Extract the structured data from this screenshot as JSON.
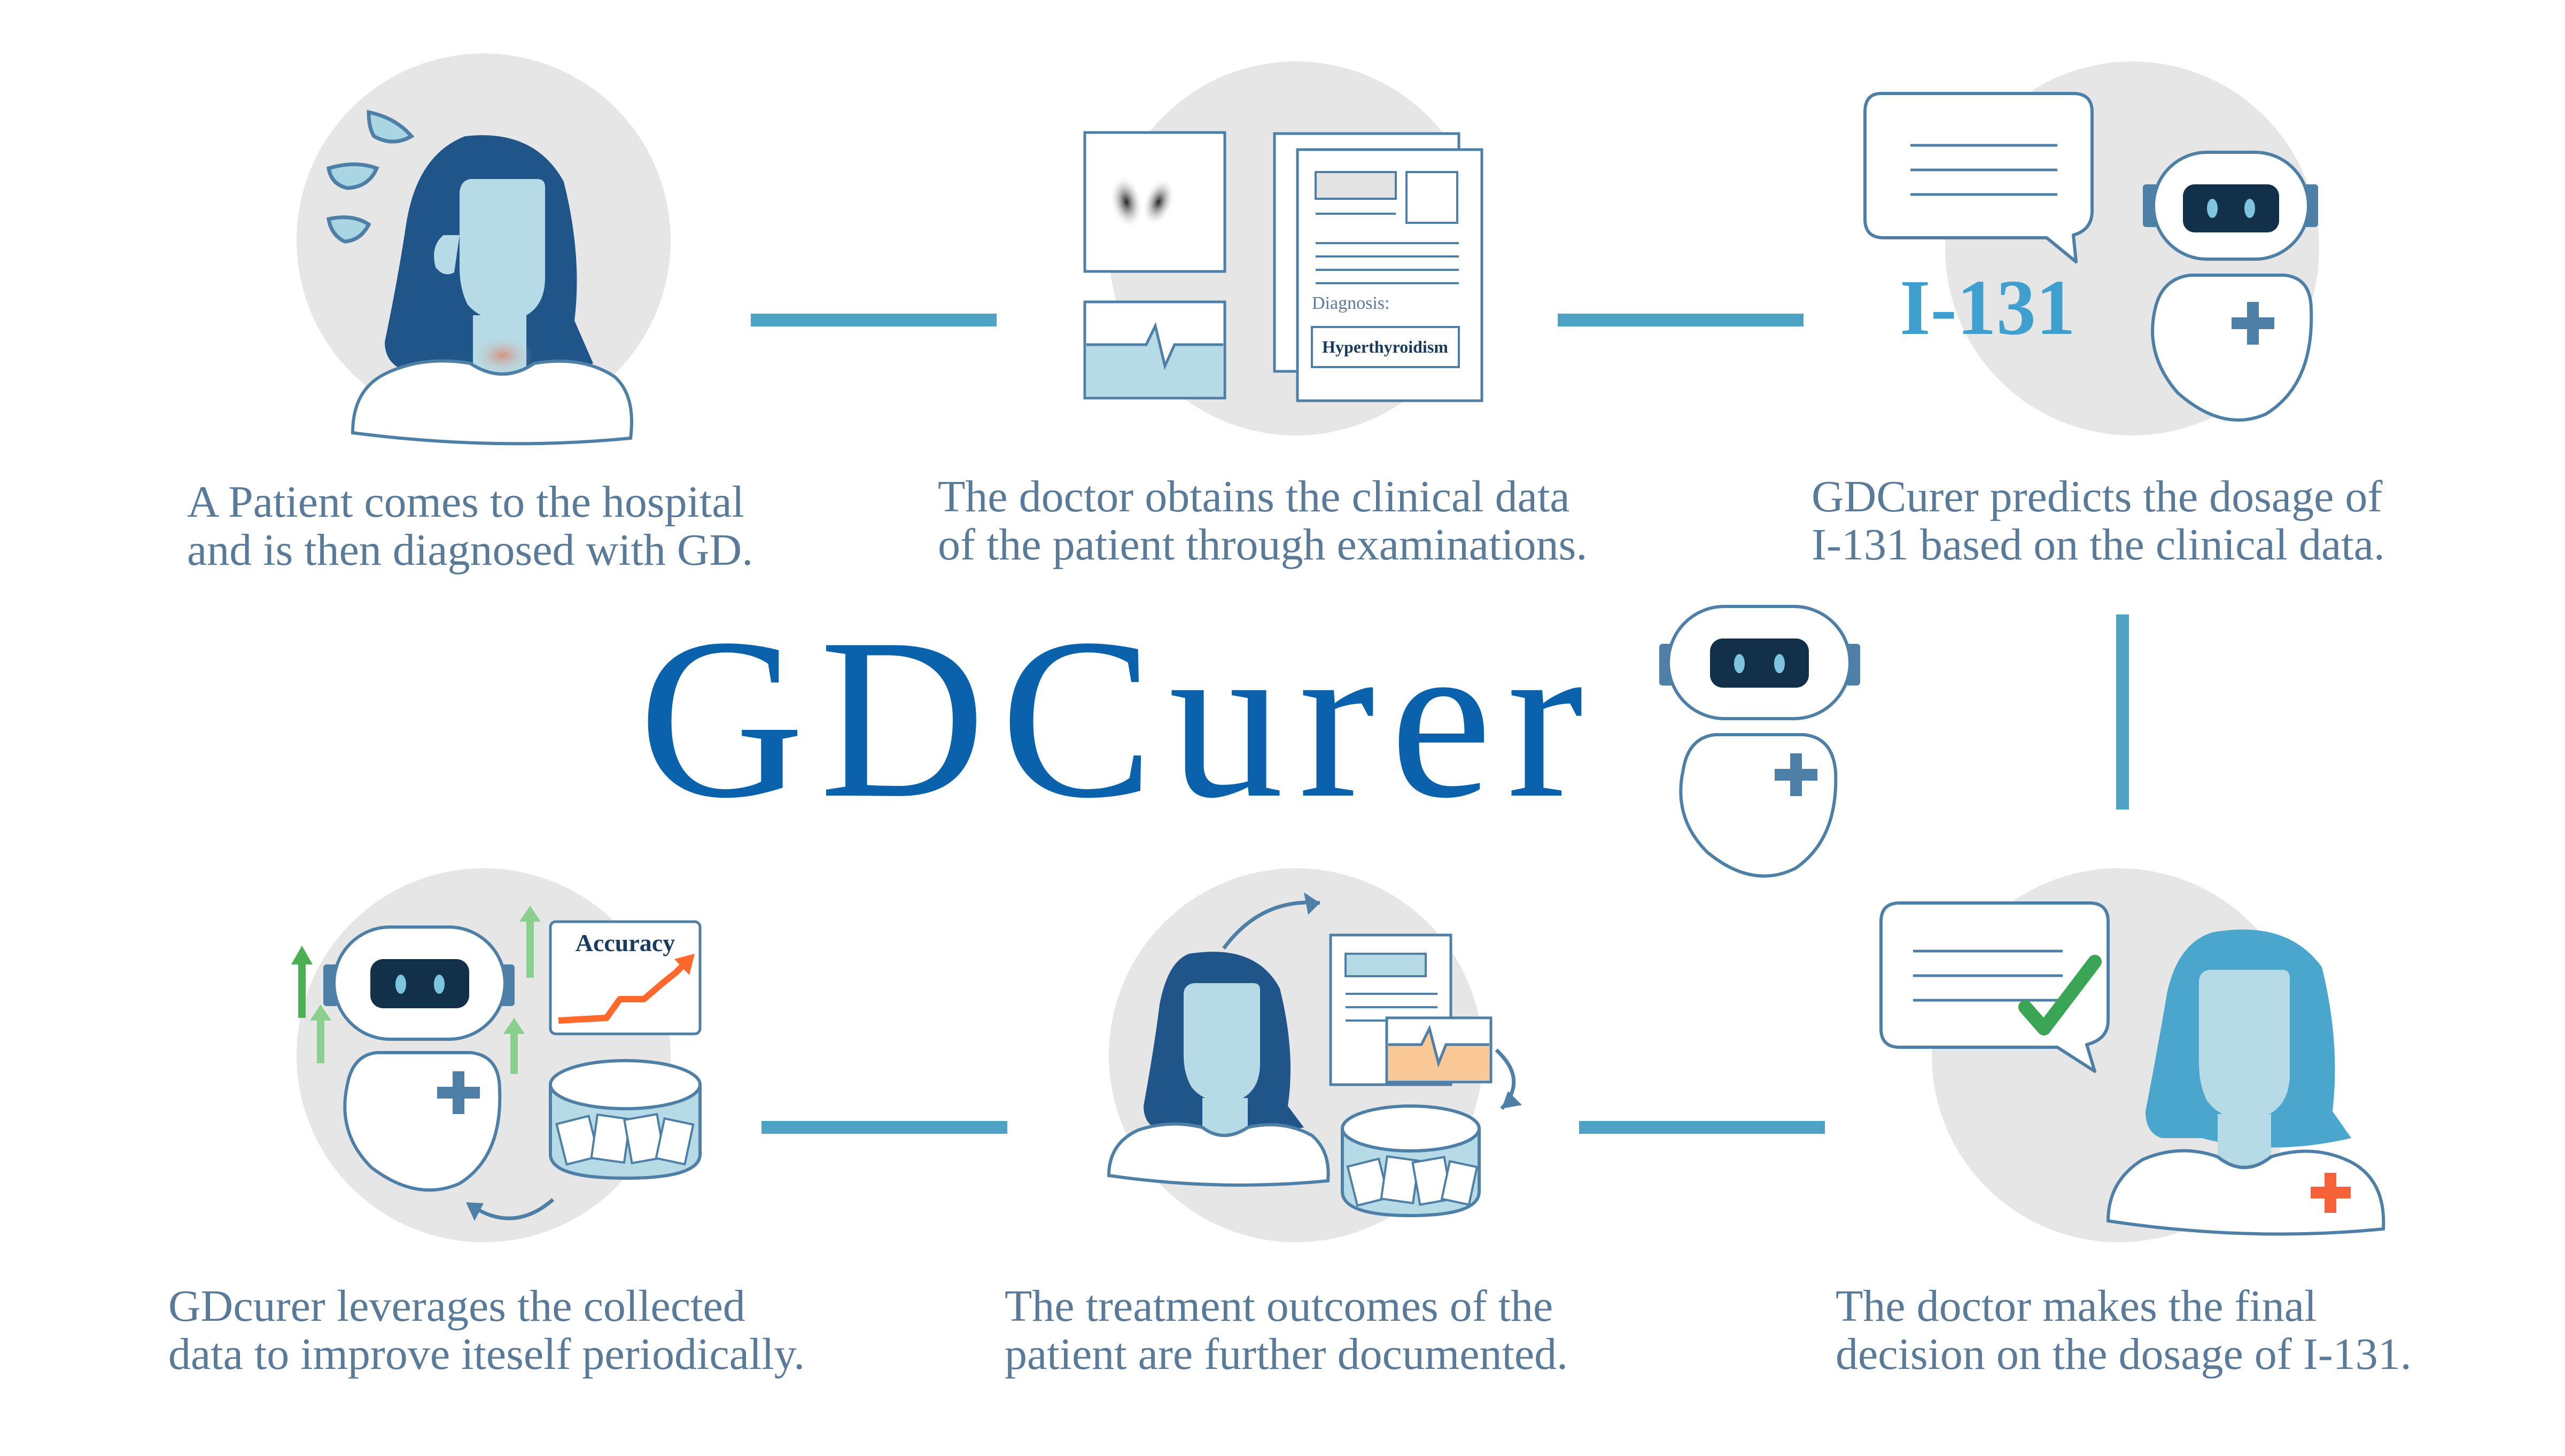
{
  "brand": {
    "title": "GDCurer"
  },
  "steps": [
    {
      "id": "patient-arrives",
      "line1": "A Patient comes to the hospital",
      "line2": "and is then diagnosed with GD."
    },
    {
      "id": "clinical-data",
      "line1": "The doctor obtains the clinical data",
      "line2": "of the patient through examinations."
    },
    {
      "id": "predict-dosage",
      "line1": "GDCurer predicts the dosage of",
      "line2": "I-131 based on the clinical data."
    },
    {
      "id": "doctor-decision",
      "line1": "The doctor makes the final",
      "line2": "decision on the dosage of I-131."
    },
    {
      "id": "document-outcome",
      "line1": "The treatment outcomes of the",
      "line2": "patient are further documented."
    },
    {
      "id": "self-improve",
      "line1": "GDcurer leverages the collected",
      "line2": "data to improve iteself periodically."
    }
  ],
  "labels": {
    "isotope": "I-131",
    "diagnosis_heading": "Diagnosis:",
    "diagnosis_value": "Hyperthyroidism",
    "accuracy": "Accuracy"
  },
  "colors": {
    "connector": "#4ea2c6",
    "brand": "#0a62ad",
    "caption": "#5a7a99",
    "circle_bg": "#e6e6e6",
    "hair_dark": "#1f5588",
    "hair_light": "#4aa6cc",
    "skin": "#b7dbe6",
    "robot_visor": "#12304a",
    "accent_green": "#4caf50",
    "accent_orange": "#ff6a2c",
    "red_cross": "#f4623a"
  }
}
